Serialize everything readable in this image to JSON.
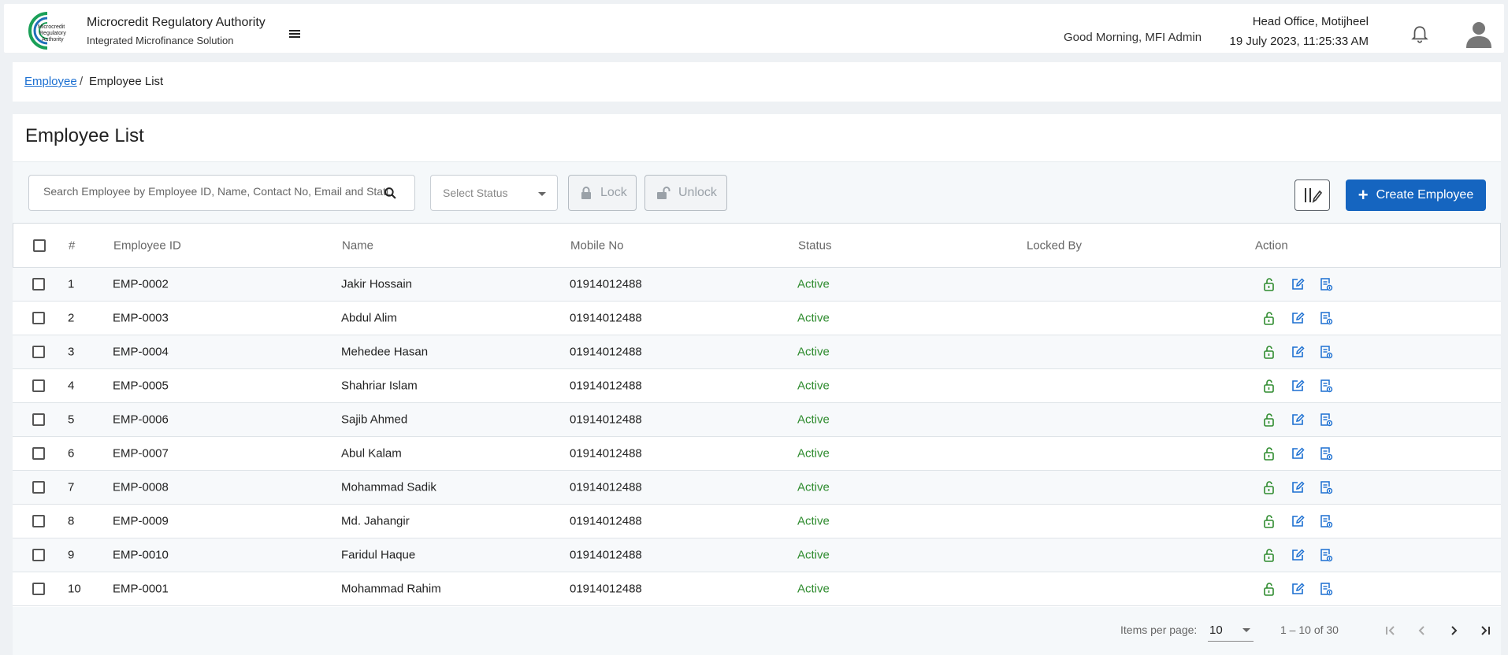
{
  "header": {
    "org_name": "Microcredit Regulatory Authority",
    "org_subtitle": "Integrated Microfinance Solution",
    "logo_text": "Microcredit Regulatory Authority",
    "greeting": "Good Morning, MFI Admin",
    "office": "Head Office, Motijheel",
    "datetime": "19 July 2023, 11:25:33 AM",
    "icons": [
      "menu-icon",
      "bell-icon",
      "user-avatar-icon"
    ]
  },
  "breadcrumb": {
    "parent": "Employee",
    "separator": "/",
    "current": "Employee List"
  },
  "page": {
    "title": "Employee List"
  },
  "toolbar": {
    "search_placeholder": "Search Employee by Employee ID, Name, Contact No, Email and Status",
    "status_placeholder": "Select Status",
    "lock_label": "Lock",
    "unlock_label": "Unlock",
    "create_label": "Create Employee",
    "accent_color": "#1565c0"
  },
  "table": {
    "columns": [
      "#",
      "Employee ID",
      "Name",
      "Mobile No",
      "Status",
      "Locked By",
      "Action"
    ],
    "rows": [
      {
        "num": "1",
        "id": "EMP-0002",
        "name": "Jakir Hossain",
        "mobile": "01914012488",
        "status": "Active",
        "locked_by": ""
      },
      {
        "num": "2",
        "id": "EMP-0003",
        "name": "Abdul Alim",
        "mobile": "01914012488",
        "status": "Active",
        "locked_by": ""
      },
      {
        "num": "3",
        "id": "EMP-0004",
        "name": "Mehedee Hasan",
        "mobile": "01914012488",
        "status": "Active",
        "locked_by": ""
      },
      {
        "num": "4",
        "id": "EMP-0005",
        "name": "Shahriar Islam",
        "mobile": "01914012488",
        "status": "Active",
        "locked_by": ""
      },
      {
        "num": "5",
        "id": "EMP-0006",
        "name": "Sajib Ahmed",
        "mobile": "01914012488",
        "status": "Active",
        "locked_by": ""
      },
      {
        "num": "6",
        "id": "EMP-0007",
        "name": "Abul Kalam",
        "mobile": "01914012488",
        "status": "Active",
        "locked_by": ""
      },
      {
        "num": "7",
        "id": "EMP-0008",
        "name": "Mohammad Sadik",
        "mobile": "01914012488",
        "status": "Active",
        "locked_by": ""
      },
      {
        "num": "8",
        "id": "EMP-0009",
        "name": "Md. Jahangir",
        "mobile": "01914012488",
        "status": "Active",
        "locked_by": ""
      },
      {
        "num": "9",
        "id": "EMP-0010",
        "name": "Faridul Haque",
        "mobile": "01914012488",
        "status": "Active",
        "locked_by": ""
      },
      {
        "num": "10",
        "id": "EMP-0001",
        "name": "Mohammad Rahim",
        "mobile": "01914012488",
        "status": "Active",
        "locked_by": ""
      }
    ],
    "action_icons": [
      "unlock-icon",
      "edit-icon",
      "details-icon"
    ],
    "status_color": "#2e8b2e"
  },
  "paginator": {
    "items_per_page_label": "Items per page:",
    "items_per_page": "10",
    "range": "1 – 10 of 30"
  }
}
